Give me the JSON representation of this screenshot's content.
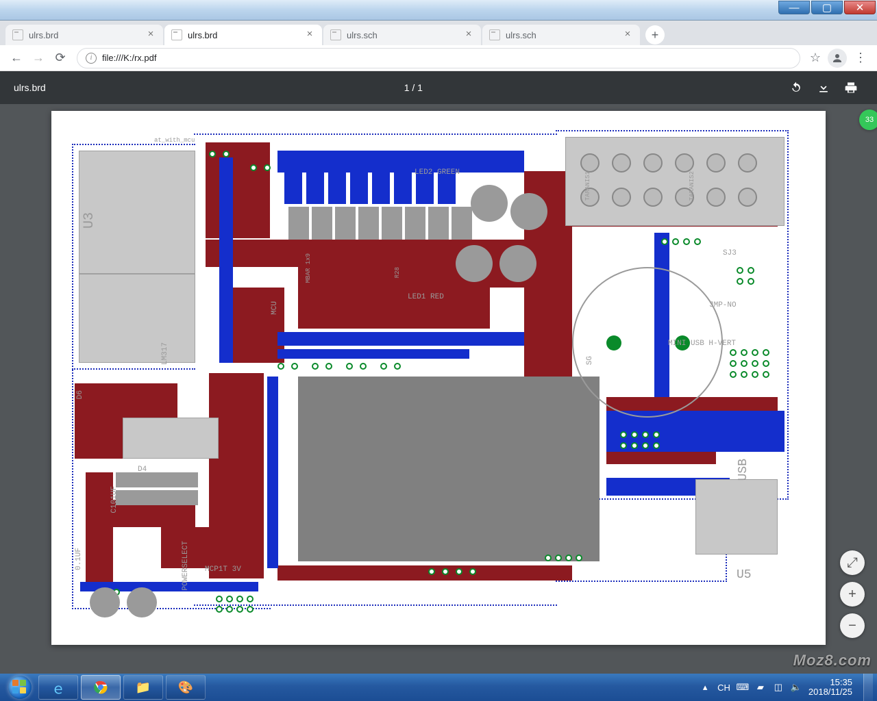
{
  "window": {
    "min": "—",
    "max": "▢",
    "close": "✕"
  },
  "tabs": [
    {
      "title": "ulrs.brd",
      "active": false
    },
    {
      "title": "ulrs.brd",
      "active": true
    },
    {
      "title": "ulrs.sch",
      "active": false
    },
    {
      "title": "ulrs.sch",
      "active": false
    }
  ],
  "newtab": "+",
  "nav": {
    "back": "←",
    "forward": "→",
    "reload": "⟳",
    "star": "☆",
    "menu": "⋮"
  },
  "omnibox": {
    "scheme_info": "i",
    "url": "file:///K:/rx.pdf"
  },
  "pdf": {
    "title": "ulrs.brd",
    "pages": "1 / 1",
    "badge": "33",
    "float": {
      "fit": "⤢",
      "zoom_in": "+",
      "zoom_out": "−"
    }
  },
  "pcb_labels": {
    "u3": "U3",
    "lm317": "LM317",
    "d6": "D6",
    "d4": "D4",
    "led1": "LED1 RED",
    "led2": "LED2 GREEN",
    "mcu": "MCU",
    "sg": "SG",
    "usb": "USB",
    "u5": "U5",
    "mcp": "MCP1T 3V",
    "pwr": "POWERSELECT",
    "jmp": "JMP-NO",
    "sj3": "SJ3",
    "c1": "C101UF",
    "cap": "0.1UF",
    "mini_usb": "MINI USB H-VERT",
    "tar1": "TARANIS1",
    "tar2": "TARANIS2",
    "at": "at_with_mcu",
    "mbar": "MBAR 1x9",
    "r28": "R28"
  },
  "tray": {
    "lang": "CH",
    "net": "◫",
    "snd": "🔈",
    "flag": "▰",
    "clock": "15:35",
    "date": "2018/11/25",
    "up": "▴"
  },
  "watermark": "Moz8.com"
}
